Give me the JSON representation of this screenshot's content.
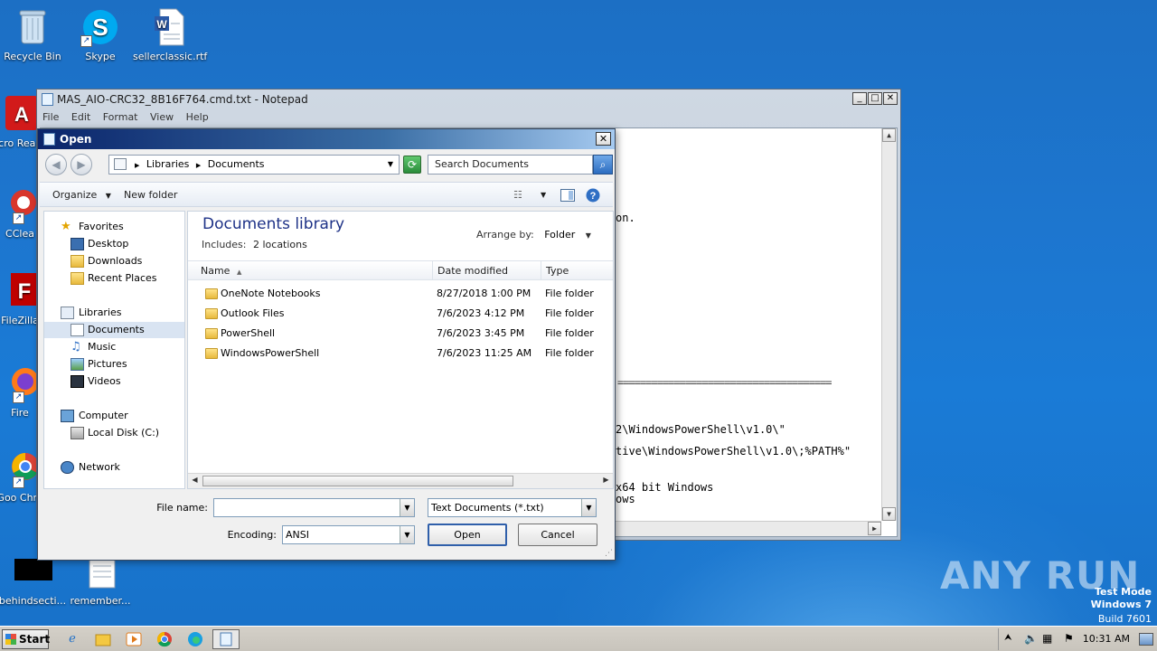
{
  "desktop": {
    "icons": [
      {
        "label": "Recycle Bin"
      },
      {
        "label": "Skype"
      },
      {
        "label": "sellerclassic.rtf"
      },
      {
        "label": "Acro Reade"
      },
      {
        "label": "CClea"
      },
      {
        "label": "FileZilla"
      },
      {
        "label": "Fire"
      },
      {
        "label": "Goo Chro"
      },
      {
        "label": "behindsecti..."
      },
      {
        "label": "remember..."
      }
    ],
    "watermark": "ANY RUN",
    "test_mode": {
      "line1": "Test Mode",
      "line2": "Windows 7",
      "line3": "Build 7601"
    }
  },
  "notepad": {
    "title": "MAS_AIO-CRC32_8B16F764.cmd.txt - Notepad",
    "menu": [
      "File",
      "Edit",
      "Format",
      "View",
      "Help"
    ],
    "visible_text": [
      "on.",
      "======================================",
      "2\\WindowsPowerShell\\v1.0\\\"",
      "tive\\WindowsPowerShell\\v1.0\\;%PATH%\"",
      "x64 bit Windows",
      "ows"
    ]
  },
  "dialog": {
    "title": "Open",
    "close_label": "✕",
    "breadcrumb": [
      "Libraries",
      "Documents"
    ],
    "search_placeholder": "Search Documents",
    "toolbar": {
      "organize": "Organize",
      "new_folder": "New folder"
    },
    "nav": {
      "favorites": "Favorites",
      "desktop": "Desktop",
      "downloads": "Downloads",
      "recent": "Recent Places",
      "libraries": "Libraries",
      "documents": "Documents",
      "music": "Music",
      "pictures": "Pictures",
      "videos": "Videos",
      "computer": "Computer",
      "local_disk": "Local Disk (C:)",
      "network": "Network"
    },
    "library": {
      "title": "Documents library",
      "includes_label": "Includes:",
      "includes_value": "2 locations",
      "arrange_label": "Arrange by:",
      "arrange_value": "Folder"
    },
    "columns": {
      "name": "Name",
      "date": "Date modified",
      "type": "Type"
    },
    "rows": [
      {
        "name": "OneNote Notebooks",
        "date": "8/27/2018 1:00 PM",
        "type": "File folder"
      },
      {
        "name": "Outlook Files",
        "date": "7/6/2023 4:12 PM",
        "type": "File folder"
      },
      {
        "name": "PowerShell",
        "date": "7/6/2023 3:45 PM",
        "type": "File folder"
      },
      {
        "name": "WindowsPowerShell",
        "date": "7/6/2023 11:25 AM",
        "type": "File folder"
      }
    ],
    "file_name_label": "File name:",
    "file_name_value": "",
    "filter_value": "Text Documents (*.txt)",
    "encoding_label": "Encoding:",
    "encoding_value": "ANSI",
    "open_label": "Open",
    "cancel_label": "Cancel"
  },
  "taskbar": {
    "start_label": "Start",
    "clock": "10:31 AM"
  }
}
